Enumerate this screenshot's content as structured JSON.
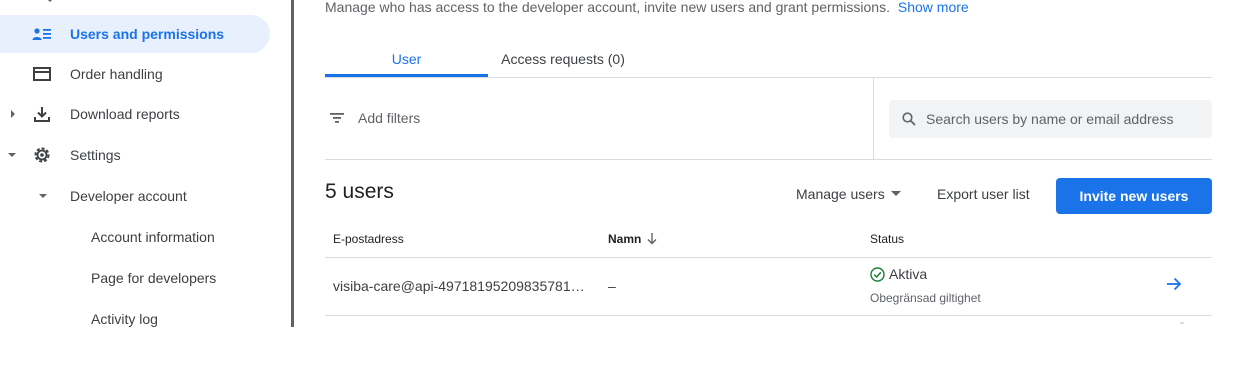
{
  "sidebar": {
    "items": [
      {
        "label": "Users and permissions",
        "icon": "users-permissions-icon",
        "active": true
      },
      {
        "label": "Order handling",
        "icon": "credit-card-icon"
      },
      {
        "label": "Download reports",
        "icon": "download-icon"
      },
      {
        "label": "Settings",
        "icon": "gear-icon"
      },
      {
        "label": "Developer account"
      },
      {
        "label": "Account information"
      },
      {
        "label": "Page for developers"
      },
      {
        "label": "Activity log"
      }
    ]
  },
  "main": {
    "description": "Manage who has access to the developer account, invite new users and grant permissions.",
    "show_more": "Show more",
    "tabs": [
      {
        "label": "User",
        "active": true
      },
      {
        "label": "Access requests (0)"
      }
    ],
    "filters_label": "Add filters",
    "search_placeholder": "Search users by name or email address",
    "user_count": "5 users",
    "manage_users": "Manage users",
    "export_user_list": "Export user list",
    "invite_new_users": "Invite new users",
    "table": {
      "columns": [
        "E-postadress",
        "Namn",
        "Status"
      ],
      "rows": [
        {
          "email": "visiba-care@api-49718195209835781…",
          "name": "–",
          "status": "Aktiva",
          "status_detail": "Obegränsad giltighet"
        }
      ]
    }
  },
  "colors": {
    "accent": "#1a73e8",
    "active_bg": "#e8f0fe",
    "status_ok": "#188038"
  }
}
